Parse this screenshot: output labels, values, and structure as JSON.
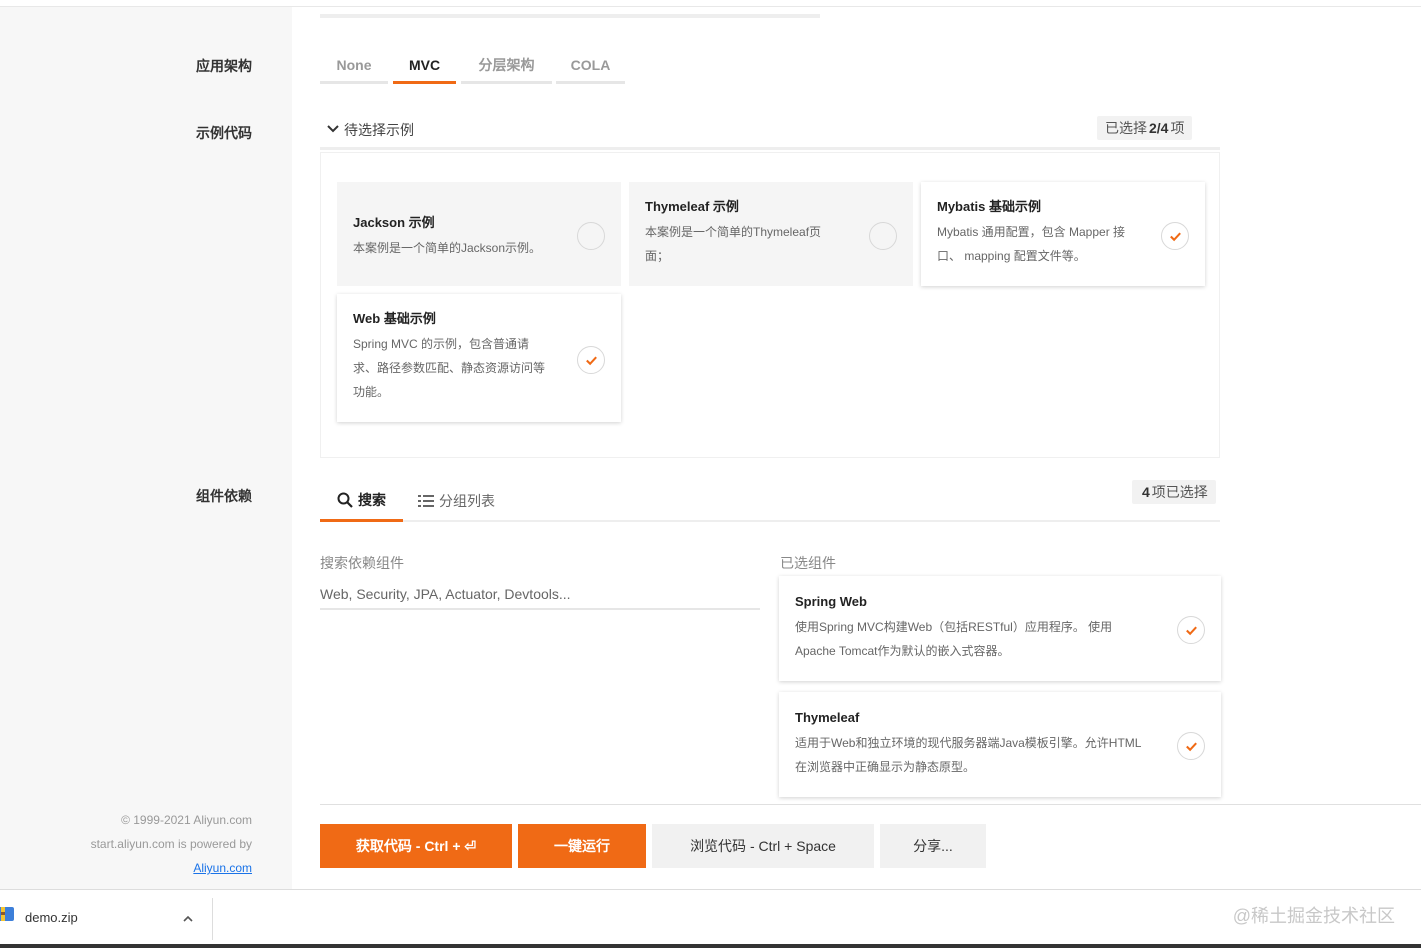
{
  "architecture": {
    "label": "应用架构",
    "tabs": [
      "None",
      "MVC",
      "分层架构",
      "COLA"
    ],
    "active": "MVC"
  },
  "samples": {
    "label": "示例代码",
    "toggle_label": "待选择示例",
    "count_prefix": "已选择",
    "count_value": "2/4",
    "count_suffix": "项",
    "cards": [
      {
        "title": "Jackson 示例",
        "desc": "本案例是一个简单的Jackson示例。",
        "selected": false
      },
      {
        "title": "Thymeleaf 示例",
        "desc": "本案例是一个简单的Thymeleaf页面；",
        "selected": false
      },
      {
        "title": "Mybatis 基础示例",
        "desc": "Mybatis 通用配置，包含 Mapper 接口、 mapping 配置文件等。",
        "selected": true
      },
      {
        "title": "Web 基础示例",
        "desc": "Spring MVC 的示例，包含普通请求、路径参数匹配、静态资源访问等功能。",
        "selected": true
      }
    ]
  },
  "dependencies": {
    "label": "组件依赖",
    "tabs": [
      "搜索",
      "分组列表"
    ],
    "count_value": "4",
    "count_suffix": "项已选择",
    "search_label": "搜索依赖组件",
    "search_placeholder": "Web, Security, JPA, Actuator, Devtools...",
    "selected_label": "已选组件",
    "selected": [
      {
        "title": "Spring Web",
        "desc": "使用Spring MVC构建Web（包括RESTful）应用程序。 使用Apache Tomcat作为默认的嵌入式容器。"
      },
      {
        "title": "Thymeleaf",
        "desc": "适用于Web和独立环境的现代服务器端Java模板引擎。允许HTML在浏览器中正确显示为静态原型。"
      }
    ]
  },
  "actions": {
    "get_code": "获取代码 - Ctrl + ⏎",
    "run": "一键运行",
    "browse": "浏览代码 - Ctrl + Space",
    "share": "分享..."
  },
  "footer": {
    "copyright": "© 1999-2021 Aliyun.com",
    "powered_by": "start.aliyun.com is powered by",
    "link": "Aliyun.com"
  },
  "download_bar": {
    "file_name": "demo.zip",
    "watermark": "@稀土掘金技术社区"
  },
  "colors": {
    "accent": "#f06a15",
    "link": "#1a73e8"
  }
}
